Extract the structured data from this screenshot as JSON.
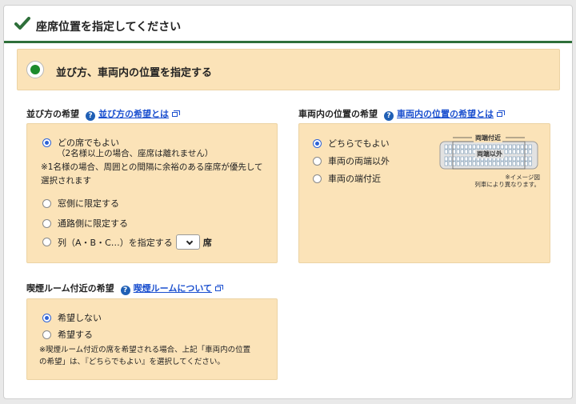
{
  "header": {
    "title": "座席位置を指定してください",
    "check_icon": "checkmark-icon"
  },
  "banner": {
    "label": "並び方、車両内の位置を指定する",
    "selected": true
  },
  "arrangement": {
    "title": "並び方の希望",
    "help_link": "並び方の希望とは",
    "options": [
      {
        "label": "どの席でもよい",
        "selected": true
      },
      {
        "label": "窓側に限定する",
        "selected": false
      },
      {
        "label": "通路側に限定する",
        "selected": false
      },
      {
        "label": "列（A・B・C…）を指定する",
        "selected": false
      }
    ],
    "note_line1": "（2名様以上の場合、座席は離れません）",
    "note_line2": "※1名様の場合、周囲との間隔に余裕のある座席が優先して",
    "note_line3": "選択されます",
    "column_select_value": "",
    "seat_suffix": "席"
  },
  "car_position": {
    "title": "車両内の位置の希望",
    "help_link": "車両内の位置の希望とは",
    "options": [
      {
        "label": "どちらでもよい",
        "selected": true
      },
      {
        "label": "車両の両端以外",
        "selected": false
      },
      {
        "label": "車両の端付近",
        "selected": false
      }
    ],
    "diagram": {
      "top_label": "両端付近",
      "middle_label": "両端以外",
      "note_line1": "※イメージ図",
      "note_line2": "列車により異なります。"
    }
  },
  "smoking": {
    "title": "喫煙ルーム付近の希望",
    "help_link": "喫煙ルームについて",
    "options": [
      {
        "label": "希望しない",
        "selected": true
      },
      {
        "label": "希望する",
        "selected": false
      }
    ],
    "note_line1": "※喫煙ルーム付近の席を希望される場合、上記「車両内の位置",
    "note_line2": "の希望」は、『どちらでもよい』を選択してください。"
  },
  "colors": {
    "accent_green": "#2e6f3a",
    "panel_bg": "#fbe3b8",
    "link": "#1a4fcf",
    "help_blue": "#1f5fb5"
  }
}
